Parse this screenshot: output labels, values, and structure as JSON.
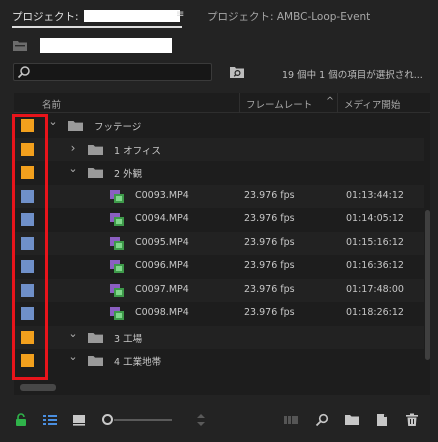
{
  "tabs": {
    "active_label": "プロジェクト: ",
    "inactive_label": "プロジェクト: AMBC-Loop-Event",
    "menu_glyph": "≡"
  },
  "search": {
    "placeholder": "",
    "value": ""
  },
  "status": {
    "selection_text": "19 個中 1 個の項目が選択され..."
  },
  "columns": {
    "name": "名前",
    "frame_rate": "フレームレート",
    "sort_indicator": "^",
    "media_start": "メディア開始"
  },
  "rows": [
    {
      "type": "folder",
      "label": "フッテージ",
      "expanded": true,
      "label_color": "#f2a01d"
    },
    {
      "type": "folder",
      "label": "1 オフィス",
      "expanded": false,
      "label_color": "#f2a01d"
    },
    {
      "type": "folder",
      "label": "2 外観",
      "expanded": true,
      "label_color": "#f2a01d"
    },
    {
      "type": "clip",
      "label": "C0093.MP4",
      "fps": "23.976 fps",
      "start": "01:13:44:12",
      "label_color": "#6f90c9"
    },
    {
      "type": "clip",
      "label": "C0094.MP4",
      "fps": "23.976 fps",
      "start": "01:14:05:12",
      "label_color": "#6f90c9"
    },
    {
      "type": "clip",
      "label": "C0095.MP4",
      "fps": "23.976 fps",
      "start": "01:15:16:12",
      "label_color": "#6f90c9"
    },
    {
      "type": "clip",
      "label": "C0096.MP4",
      "fps": "23.976 fps",
      "start": "01:16:36:12",
      "label_color": "#6f90c9"
    },
    {
      "type": "clip",
      "label": "C0097.MP4",
      "fps": "23.976 fps",
      "start": "01:17:48:00",
      "label_color": "#6f90c9"
    },
    {
      "type": "clip",
      "label": "C0098.MP4",
      "fps": "23.976 fps",
      "start": "01:18:26:12",
      "label_color": "#6f90c9"
    },
    {
      "type": "folder",
      "label": "3 工場",
      "expanded": true,
      "label_color": "#f2a01d"
    },
    {
      "type": "folder",
      "label": "4 工業地帯",
      "expanded": true,
      "label_color": "#f2a01d"
    }
  ],
  "highlight": {
    "color": "#e8141b"
  },
  "toolbar": {
    "icons": [
      "lock-icon",
      "list-view-icon",
      "icon-view-icon",
      "zoom-slider",
      "sort-icon",
      "automate-to-sequence-icon",
      "find-icon",
      "new-bin-icon",
      "new-item-icon",
      "trash-icon"
    ]
  }
}
